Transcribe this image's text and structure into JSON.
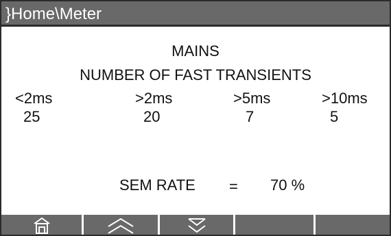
{
  "window": {
    "title": "}Home\\Meter"
  },
  "screen": {
    "heading": "MAINS",
    "subheading": "NUMBER OF FAST TRANSIENTS",
    "columns": [
      "<2ms",
      ">2ms",
      ">5ms",
      ">10ms"
    ],
    "counts": [
      "25",
      "20",
      "7",
      "5"
    ],
    "sem_rate": {
      "label": "SEM RATE",
      "equals": "=",
      "value": "70 %"
    }
  },
  "softkeys": [
    {
      "icon": "home-icon"
    },
    {
      "icon": "chevron-up-icon"
    },
    {
      "icon": "chevron-down-icon"
    },
    {
      "icon": ""
    },
    {
      "icon": ""
    }
  ],
  "colors": {
    "titlebar": "#696969",
    "background": "#ffffff",
    "text": "#111111"
  }
}
